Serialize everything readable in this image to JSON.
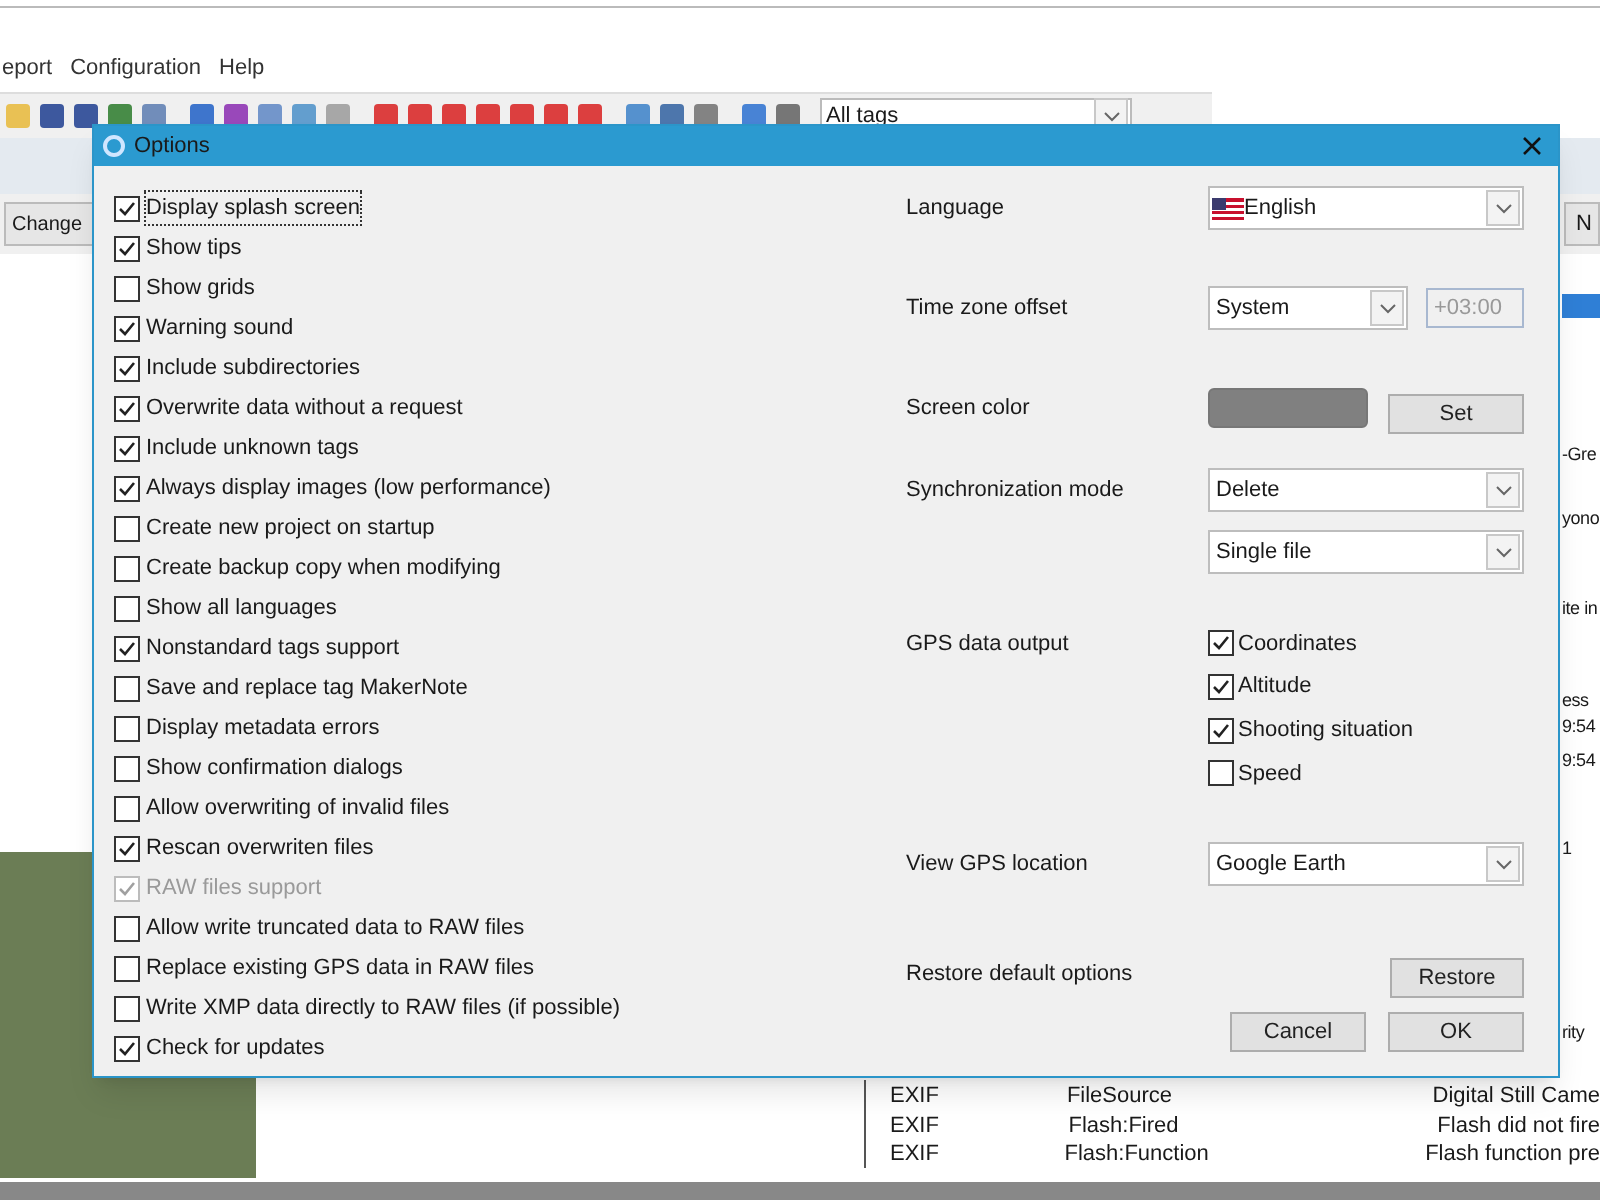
{
  "menu": [
    {
      "label": "eport"
    },
    {
      "label": "Configuration"
    },
    {
      "label": "Help"
    }
  ],
  "toolbar": {
    "filter": "All tags"
  },
  "background": {
    "button": "Change",
    "button_2": "N",
    "fragments": [
      "-Gre",
      "yono",
      "ite in",
      "ess",
      "9:54",
      "9:54",
      "1",
      "rity"
    ],
    "table_rows": [
      {
        "group": "EXIF",
        "tag": "FileSource",
        "value": "Digital Still Came"
      },
      {
        "group": "EXIF",
        "tag": "Flash:Fired",
        "value": "Flash did not fire"
      },
      {
        "group": "EXIF",
        "tag": "Flash:Function",
        "value": "Flash function pre"
      }
    ]
  },
  "dialog": {
    "title": "Options",
    "options": [
      {
        "label": "Display splash screen",
        "checked": true,
        "disabled": false,
        "focused": true
      },
      {
        "label": "Show tips",
        "checked": true,
        "disabled": false,
        "focused": false
      },
      {
        "label": "Show grids",
        "checked": false,
        "disabled": false,
        "focused": false
      },
      {
        "label": "Warning sound",
        "checked": true,
        "disabled": false,
        "focused": false
      },
      {
        "label": "Include subdirectories",
        "checked": true,
        "disabled": false,
        "focused": false
      },
      {
        "label": "Overwrite data without a request",
        "checked": true,
        "disabled": false,
        "focused": false
      },
      {
        "label": "Include unknown tags",
        "checked": true,
        "disabled": false,
        "focused": false
      },
      {
        "label": "Always display images (low performance)",
        "checked": true,
        "disabled": false,
        "focused": false
      },
      {
        "label": "Create new project on startup",
        "checked": false,
        "disabled": false,
        "focused": false
      },
      {
        "label": "Create backup copy when modifying",
        "checked": false,
        "disabled": false,
        "focused": false
      },
      {
        "label": "Show all languages",
        "checked": false,
        "disabled": false,
        "focused": false
      },
      {
        "label": "Nonstandard tags support",
        "checked": true,
        "disabled": false,
        "focused": false
      },
      {
        "label": "Save and replace tag MakerNote",
        "checked": false,
        "disabled": false,
        "focused": false
      },
      {
        "label": "Display metadata errors",
        "checked": false,
        "disabled": false,
        "focused": false
      },
      {
        "label": "Show confirmation dialogs",
        "checked": false,
        "disabled": false,
        "focused": false
      },
      {
        "label": "Allow overwriting of invalid files",
        "checked": false,
        "disabled": false,
        "focused": false
      },
      {
        "label": "Rescan overwriten files",
        "checked": true,
        "disabled": false,
        "focused": false
      },
      {
        "label": "RAW files support",
        "checked": true,
        "disabled": true,
        "focused": false
      },
      {
        "label": "Allow write truncated data to RAW files",
        "checked": false,
        "disabled": false,
        "focused": false
      },
      {
        "label": "Replace existing GPS data in RAW files",
        "checked": false,
        "disabled": false,
        "focused": false
      },
      {
        "label": "Write XMP data directly to RAW files (if possible)",
        "checked": false,
        "disabled": false,
        "focused": false
      },
      {
        "label": "Check for updates",
        "checked": true,
        "disabled": false,
        "focused": false
      }
    ],
    "settings": [
      {
        "kind": "language",
        "label": "Language",
        "value": "English"
      },
      {
        "kind": "timezone",
        "label": "Time zone offset",
        "value": "System",
        "offset": "+03:00"
      },
      {
        "kind": "color",
        "label": "Screen color",
        "color": "#808080",
        "button": "Set"
      },
      {
        "kind": "sync",
        "label": "Synchronization mode",
        "value": "Delete",
        "value_2": "Single file"
      },
      {
        "kind": "checks",
        "label": "GPS data output",
        "items": [
          {
            "label": "Coordinates",
            "checked": true
          },
          {
            "label": "Altitude",
            "checked": true
          },
          {
            "label": "Shooting situation",
            "checked": true
          },
          {
            "label": "Speed",
            "checked": false
          }
        ]
      },
      {
        "kind": "select",
        "label": "View GPS location",
        "value": "Google Earth"
      },
      {
        "kind": "button",
        "label": "Restore default options",
        "button": "Restore"
      }
    ],
    "buttons": [
      "Cancel",
      "OK"
    ]
  }
}
